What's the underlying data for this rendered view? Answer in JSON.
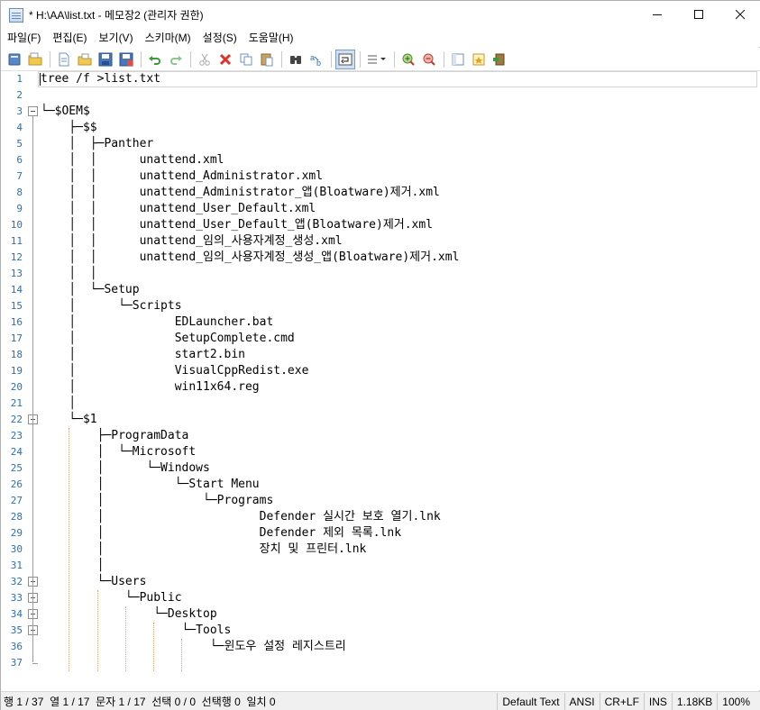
{
  "window": {
    "title": "* H:\\AA\\list.txt - 메모장2 (관리자 권한)",
    "minimize_glyph": "—",
    "maximize_glyph": "☐",
    "close_glyph": "✕"
  },
  "menu": [
    "파일(F)",
    "편집(E)",
    "보기(V)",
    "스키마(M)",
    "설정(S)",
    "도움말(H)"
  ],
  "toolbar": {
    "icons": [
      "new-icon",
      "open-icon",
      "browse-icon",
      "save-icon",
      "save-as-icon",
      "undo-icon",
      "redo-icon",
      "cut-icon",
      "delete-icon",
      "copy-icon",
      "paste-icon",
      "find-icon",
      "replace-icon",
      "word-wrap-icon",
      "schema-icon",
      "zoom-in-icon",
      "zoom-out-icon",
      "settings-icon",
      "favorites-icon",
      "exit-icon"
    ],
    "active": "word-wrap-icon"
  },
  "editor": {
    "line_numbers": [
      "1",
      "2",
      "3",
      "4",
      "5",
      "6",
      "7",
      "8",
      "9",
      "10",
      "11",
      "12",
      "13",
      "14",
      "15",
      "16",
      "17",
      "18",
      "19",
      "20",
      "21",
      "22",
      "23",
      "24",
      "25",
      "26",
      "27",
      "28",
      "29",
      "30",
      "31",
      "32",
      "33",
      "34",
      "35",
      "36",
      "37"
    ],
    "lines": [
      "tree /f >list.txt",
      "",
      "└─$OEM$",
      "    ├─$$",
      "    │  ├─Panther",
      "    │  │      unattend.xml",
      "    │  │      unattend_Administrator.xml",
      "    │  │      unattend_Administrator_앱(Bloatware)제거.xml",
      "    │  │      unattend_User_Default.xml",
      "    │  │      unattend_User_Default_앱(Bloatware)제거.xml",
      "    │  │      unattend_임의_사용자계정_생성.xml",
      "    │  │      unattend_임의_사용자계정_생성_앱(Bloatware)제거.xml",
      "    │  │",
      "    │  └─Setup",
      "    │      └─Scripts",
      "    │              EDLauncher.bat",
      "    │              SetupComplete.cmd",
      "    │              start2.bin",
      "    │              VisualCppRedist.exe",
      "    │              win11x64.reg",
      "    │",
      "    └─$1",
      "        ├─ProgramData",
      "        │  └─Microsoft",
      "        │      └─Windows",
      "        │          └─Start Menu",
      "        │              └─Programs",
      "        │                      Defender 실시간 보호 열기.lnk",
      "        │                      Defender 제외 목록.lnk",
      "        │                      장치 및 프린터.lnk",
      "        │",
      "        └─Users",
      "            └─Public",
      "                └─Desktop",
      "                    └─Tools",
      "                        └─윈도우 설정 레지스트리",
      ""
    ]
  },
  "statusbar": {
    "position": "행 1 / 37  열 1 / 17  문자 1 / 17  선택 0 / 0  선택행 0  일치 0",
    "schema": "Default Text",
    "encoding": "ANSI",
    "line_ending": "CR+LF",
    "mode": "INS",
    "size": "1.18KB",
    "zoom": "100%"
  }
}
